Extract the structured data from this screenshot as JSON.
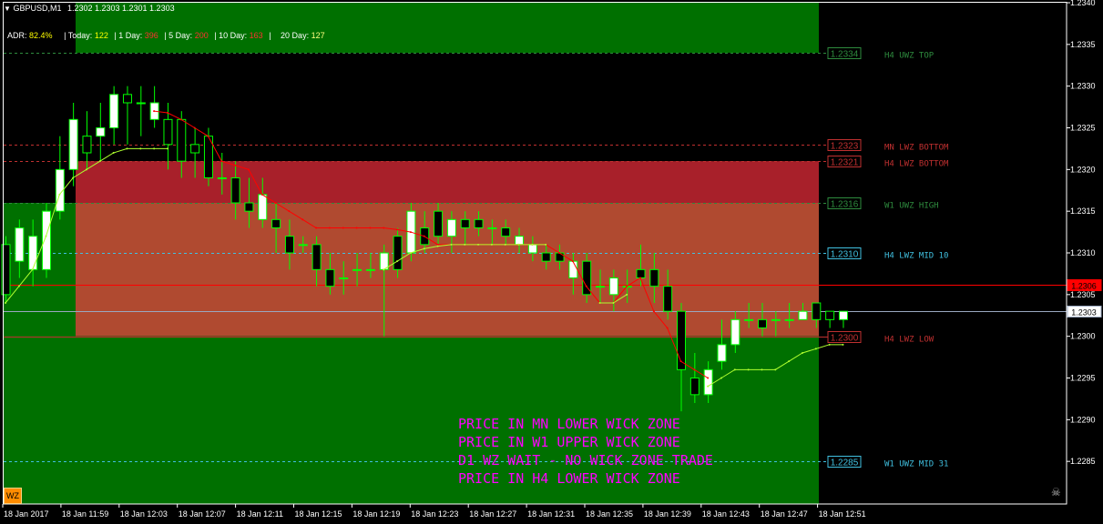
{
  "header": {
    "symbol": "GBPUSD,M1",
    "ohlc": "1.2302 1.2303 1.2301 1.2303"
  },
  "adr": {
    "adr_label": "ADR:",
    "adr_value": "82.4%",
    "today_label": "Today:",
    "today_value": "122",
    "d1_label": "1 Day:",
    "d1_value": "396",
    "d5_label": "5 Day:",
    "d5_value": "200",
    "d10_label": "10 Day:",
    "d10_value": "163",
    "d20_label": "20 Day:",
    "d20_value": "127"
  },
  "colors": {
    "bg": "#000000",
    "green_zone": "#007000",
    "red_zone": "#a8202a",
    "orange_zone": "#b04a30",
    "bull": "#ffffff",
    "bear": "#000000",
    "wick": "#00ff00",
    "ma_red": "#ff0000",
    "ma_yellow": "#adff2f",
    "message": "#ff00ff"
  },
  "messages": [
    "PRICE IN MN LOWER WICK ZONE",
    "PRICE IN W1 UPPER WICK ZONE",
    "D1 WZ WAIT - NO WICK ZONE TRADE",
    "PRICE IN H4 LOWER WICK ZONE"
  ],
  "badge": {
    "text": "WZ"
  },
  "chart_data": {
    "type": "candlestick",
    "ylim": [
      1.228,
      1.234
    ],
    "y_ticks": [
      "1.2340",
      "1.2335",
      "1.2330",
      "1.2325",
      "1.2320",
      "1.2315",
      "1.2310",
      "1.2305",
      "1.2300",
      "1.2295",
      "1.2290",
      "1.2285"
    ],
    "x_ticks": [
      "18 Jan 2017",
      "18 Jan 11:59",
      "18 Jan 12:03",
      "18 Jan 12:07",
      "18 Jan 12:11",
      "18 Jan 12:15",
      "18 Jan 12:19",
      "18 Jan 12:23",
      "18 Jan 12:27",
      "18 Jan 12:31",
      "18 Jan 12:35",
      "18 Jan 12:39",
      "18 Jan 12:43",
      "18 Jan 12:47",
      "18 Jan 12:51"
    ],
    "zones": [
      {
        "name": "top-green",
        "from": 1.2334,
        "to": 1.234,
        "color": "#007000"
      },
      {
        "name": "mn-red",
        "from": 1.2321,
        "to": 1.2316,
        "color": "#a8202a"
      },
      {
        "name": "orange",
        "from": 1.2316,
        "to": 1.23,
        "color": "#b04a30"
      },
      {
        "name": "left-green",
        "from": 1.2316,
        "to": 1.228,
        "color": "#007000"
      },
      {
        "name": "bottom-green",
        "from": 1.23,
        "to": 1.228,
        "color": "#007000"
      }
    ],
    "levels": [
      {
        "value": 1.2334,
        "label": "1.2334",
        "text": "H4 UWZ TOP",
        "color": "#2e8b3e",
        "style": "dash"
      },
      {
        "value": 1.2323,
        "label": "1.2323",
        "text": "MN LWZ BOTTOM",
        "color": "#c03030",
        "style": "dash"
      },
      {
        "value": 1.2321,
        "label": "1.2321",
        "text": "H4 LWZ BOTTOM",
        "color": "#c03030",
        "style": "dash"
      },
      {
        "value": 1.2316,
        "label": "1.2316",
        "text": "W1 UWZ HIGH",
        "color": "#2e8b3e",
        "style": "dash"
      },
      {
        "value": 1.231,
        "label": "1.2310",
        "text": "H4 LWZ MID 10",
        "color": "#40c0e0",
        "style": "dash"
      },
      {
        "value": 1.23,
        "label": "1.2300",
        "text": "H4 LWZ LOW",
        "color": "#c03030",
        "style": "solid"
      },
      {
        "value": 1.2285,
        "label": "1.2285",
        "text": "W1 UWZ MID 31",
        "color": "#40c0e0",
        "style": "dash"
      }
    ],
    "bid": {
      "value": 1.23062,
      "label": "1.2306",
      "color": "#ff0000"
    },
    "ask": {
      "value": 1.2303,
      "label": "1.2303",
      "color": "#9aa8c0"
    },
    "candles": [
      [
        1.2311,
        1.2305,
        1.2312,
        1.2304
      ],
      [
        1.2309,
        1.2313,
        1.2314,
        1.2307
      ],
      [
        1.2308,
        1.2312,
        1.2314,
        1.2306
      ],
      [
        1.2308,
        1.2315,
        1.2316,
        1.2307
      ],
      [
        1.2315,
        1.232,
        1.2324,
        1.2314
      ],
      [
        1.232,
        1.2326,
        1.2328,
        1.2318
      ],
      [
        1.2324,
        1.2322,
        1.2327,
        1.232
      ],
      [
        1.2324,
        1.2325,
        1.2328,
        1.2321
      ],
      [
        1.2325,
        1.2329,
        1.233,
        1.2323
      ],
      [
        1.2329,
        1.2328,
        1.233,
        1.2323
      ],
      [
        1.2328,
        1.2328,
        1.233,
        1.2324
      ],
      [
        1.2326,
        1.2328,
        1.233,
        1.2325
      ],
      [
        1.2326,
        1.2323,
        1.2328,
        1.232
      ],
      [
        1.2326,
        1.2321,
        1.2327,
        1.2319
      ],
      [
        1.2323,
        1.2322,
        1.2325,
        1.2319
      ],
      [
        1.2324,
        1.2319,
        1.2325,
        1.2318
      ],
      [
        1.2319,
        1.2319,
        1.2322,
        1.2317
      ],
      [
        1.2319,
        1.2316,
        1.2321,
        1.2314
      ],
      [
        1.2316,
        1.2315,
        1.2319,
        1.2313
      ],
      [
        1.2314,
        1.2317,
        1.2319,
        1.2313
      ],
      [
        1.2314,
        1.2313,
        1.2316,
        1.231
      ],
      [
        1.2312,
        1.231,
        1.2314,
        1.2308
      ],
      [
        1.2311,
        1.2311,
        1.2312,
        1.231
      ],
      [
        1.2311,
        1.2308,
        1.2312,
        1.2306
      ],
      [
        1.2308,
        1.2306,
        1.231,
        1.2305
      ],
      [
        1.2307,
        1.2307,
        1.2309,
        1.2305
      ],
      [
        1.2308,
        1.2308,
        1.231,
        1.2306
      ],
      [
        1.2308,
        1.2308,
        1.231,
        1.2307
      ],
      [
        1.2308,
        1.231,
        1.2311,
        1.23
      ],
      [
        1.2312,
        1.2308,
        1.2313,
        1.2307
      ],
      [
        1.231,
        1.2315,
        1.2316,
        1.2309
      ],
      [
        1.2313,
        1.2311,
        1.2315,
        1.231
      ],
      [
        1.2315,
        1.2312,
        1.2316,
        1.2311
      ],
      [
        1.2312,
        1.2314,
        1.2315,
        1.231
      ],
      [
        1.2314,
        1.2313,
        1.2315,
        1.2311
      ],
      [
        1.2314,
        1.2313,
        1.2315,
        1.2312
      ],
      [
        1.2313,
        1.2313,
        1.2314,
        1.2311
      ],
      [
        1.2313,
        1.2312,
        1.2314,
        1.2311
      ],
      [
        1.2311,
        1.2312,
        1.2313,
        1.231
      ],
      [
        1.231,
        1.2311,
        1.2312,
        1.2309
      ],
      [
        1.231,
        1.2309,
        1.2311,
        1.2308
      ],
      [
        1.231,
        1.2309,
        1.2311,
        1.2308
      ],
      [
        1.2307,
        1.2309,
        1.231,
        1.2305
      ],
      [
        1.2309,
        1.2305,
        1.231,
        1.2304
      ],
      [
        1.2306,
        1.2306,
        1.2308,
        1.2304
      ],
      [
        1.2305,
        1.2307,
        1.2308,
        1.2303
      ],
      [
        1.2306,
        1.2306,
        1.2308,
        1.2304
      ],
      [
        1.2308,
        1.2307,
        1.2311,
        1.2306
      ],
      [
        1.2308,
        1.2306,
        1.231,
        1.2304
      ],
      [
        1.2306,
        1.2303,
        1.2308,
        1.2302
      ],
      [
        1.2303,
        1.2296,
        1.2304,
        1.2291
      ],
      [
        1.2295,
        1.2293,
        1.2298,
        1.2292
      ],
      [
        1.2293,
        1.2296,
        1.2297,
        1.2292
      ],
      [
        1.2297,
        1.2299,
        1.2302,
        1.2296
      ],
      [
        1.2299,
        1.2302,
        1.2303,
        1.2298
      ],
      [
        1.2302,
        1.2302,
        1.2304,
        1.2301
      ],
      [
        1.2302,
        1.2301,
        1.2304,
        1.23
      ],
      [
        1.2302,
        1.2302,
        1.2303,
        1.23
      ],
      [
        1.2302,
        1.2302,
        1.2304,
        1.2301
      ],
      [
        1.2302,
        1.2303,
        1.2304,
        1.2302
      ],
      [
        1.2304,
        1.2302,
        1.2304,
        1.2301
      ],
      [
        1.2303,
        1.2302,
        1.2303,
        1.2301
      ],
      [
        1.2302,
        1.2303,
        1.2303,
        1.2301
      ]
    ],
    "ma_red": [
      null,
      null,
      null,
      null,
      null,
      null,
      null,
      null,
      null,
      null,
      null,
      1.2327,
      1.23268,
      1.2326,
      1.2325,
      1.2324,
      1.2321,
      1.23205,
      1.232,
      1.2317,
      1.2316,
      1.2315,
      1.2314,
      1.2313,
      1.2313,
      1.2313,
      1.2313,
      1.2313,
      1.2313,
      1.23128,
      1.23125,
      1.2312,
      1.2311,
      1.2311,
      1.2311,
      1.2311,
      1.2311,
      1.2311,
      1.2311,
      1.2311,
      1.2311,
      1.231,
      1.2309,
      1.2306,
      1.2304,
      1.2304,
      1.2306,
      1.2307,
      1.2303,
      1.2301,
      1.2297,
      1.2296,
      1.2295,
      null,
      null,
      null,
      null,
      null,
      null,
      null,
      null,
      null,
      null
    ],
    "ma_yellow": [
      1.2304,
      1.2306,
      1.2308,
      1.2312,
      1.2317,
      1.2319,
      1.232,
      1.2321,
      1.2322,
      1.23225,
      1.23225,
      1.23225,
      1.23225,
      null,
      null,
      null,
      null,
      null,
      null,
      null,
      null,
      null,
      null,
      null,
      null,
      null,
      null,
      null,
      1.2308,
      1.2309,
      1.231,
      1.23105,
      1.23108,
      1.2311,
      1.2311,
      1.2311,
      1.2311,
      1.2311,
      1.2311,
      1.2311,
      1.2311,
      null,
      null,
      null,
      1.2304,
      1.2304,
      1.2305,
      null,
      null,
      null,
      null,
      null,
      1.2294,
      1.2295,
      1.2296,
      1.2296,
      1.2296,
      1.2296,
      1.2297,
      1.2298,
      1.22985,
      1.2299,
      1.2299
    ]
  }
}
